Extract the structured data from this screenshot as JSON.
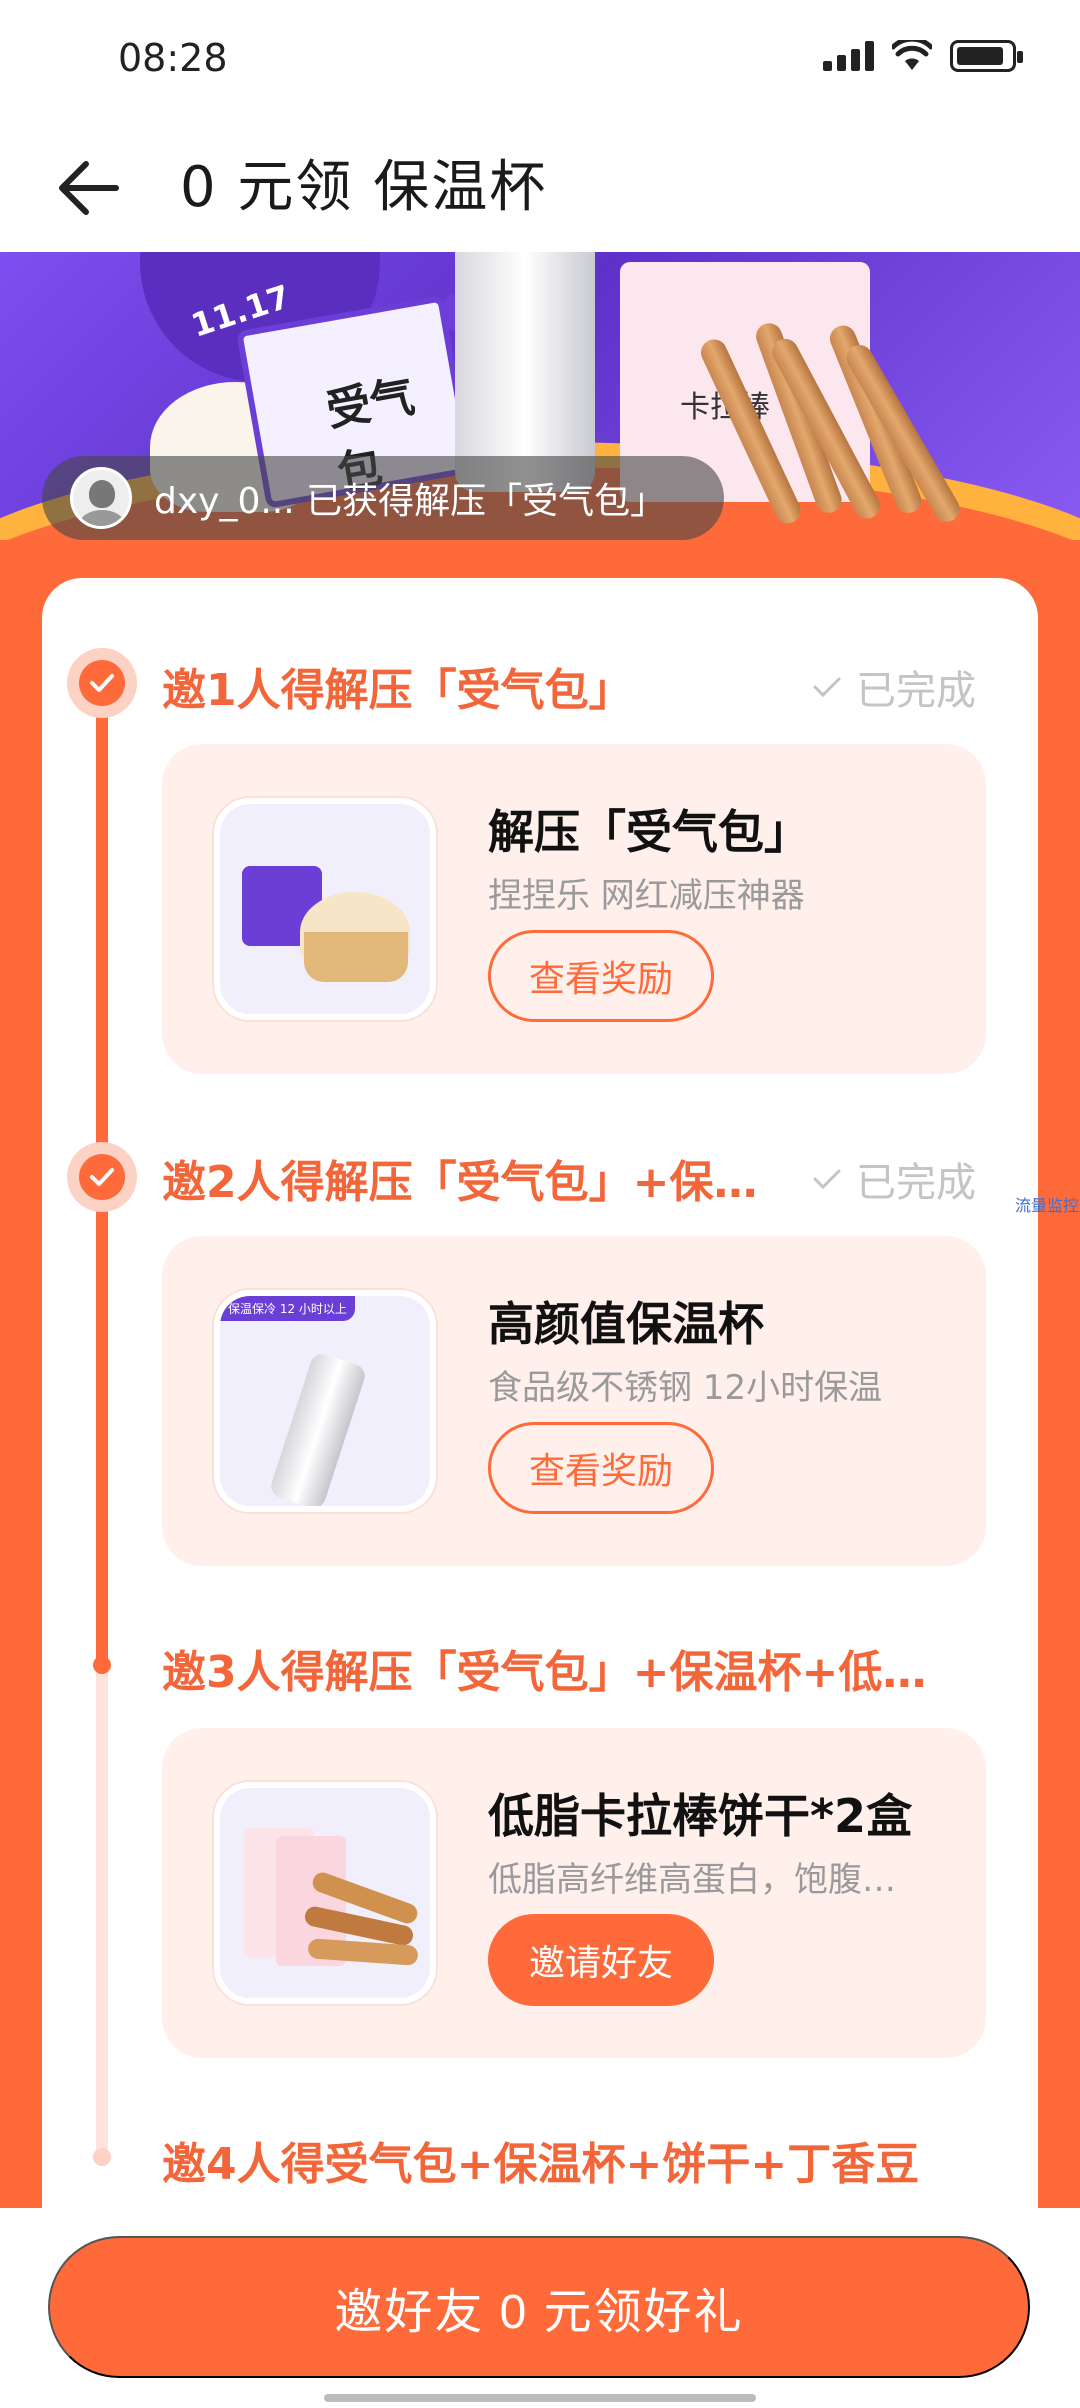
{
  "status_bar": {
    "time": "08:28"
  },
  "header": {
    "title": "0 元领 保温杯"
  },
  "banner": {
    "badge_text": "11.17",
    "box1_text": "受气包",
    "box2_text": "卡拉棒"
  },
  "winner": {
    "text": "dxy_0...  已获得解压「受气包」"
  },
  "steps": [
    {
      "title": "邀1人得解压「受气包」",
      "status": "已完成",
      "reward_name": "解压「受气包」",
      "reward_desc": "捏捏乐 网红减压神器",
      "button": "查看奖励"
    },
    {
      "title": "邀2人得解压「受气包」+保…",
      "status": "已完成",
      "reward_name": "高颜值保温杯",
      "reward_desc": "食品级不锈钢 12小时保温",
      "button": "查看奖励",
      "img_tag": "保温保冷 12 小时以上"
    },
    {
      "title": "邀3人得解压「受气包」+保温杯+低…",
      "status": "",
      "reward_name": "低脂卡拉棒饼干*2盒",
      "reward_desc": "低脂高纤维高蛋白，饱腹…",
      "button": "邀请好友"
    },
    {
      "title": "邀4人得受气包+保温杯+饼干+丁香豆"
    }
  ],
  "side_link": "流量监控",
  "cta": {
    "label": "邀好友 0 元领好礼"
  },
  "colors": {
    "accent": "#ff6a3a",
    "accent_light": "#fff0ec",
    "banner_purple": "#6f3fe0"
  }
}
